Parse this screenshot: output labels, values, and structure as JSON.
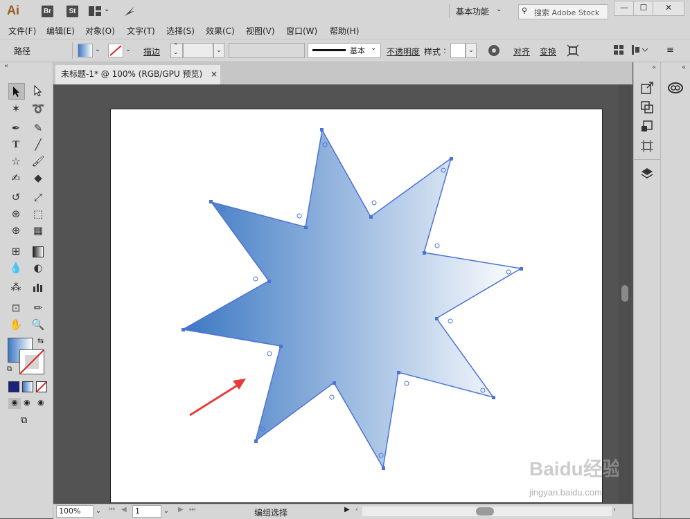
{
  "app": {
    "logo": "Ai",
    "bridge": "Br",
    "stock_app": "St",
    "workspace": "基本功能",
    "search_placeholder": "搜索 Adobe Stock",
    "min": "—",
    "max": "☐",
    "close": "✕"
  },
  "menu": [
    "文件(F)",
    "编辑(E)",
    "对象(O)",
    "文字(T)",
    "选择(S)",
    "效果(C)",
    "视图(V)",
    "窗口(W)",
    "帮助(H)"
  ],
  "control": {
    "selection_type": "路径",
    "stroke_label": "描边",
    "stroke_style": "基本",
    "opacity_label": "不透明度",
    "style_label": "样式",
    "align_label": "对齐",
    "transform_label": "变换"
  },
  "document": {
    "tab_title": "未标题-1* @ 100% (RGB/GPU 预览)",
    "tab_close": "×"
  },
  "status": {
    "zoom": "100%",
    "artboard_num": "1",
    "tool_status": "编组选择"
  },
  "watermark": {
    "line1": "Baidu经验",
    "line2": "jingyan.baidu.com"
  },
  "colors": {
    "gradient_start": "#3c78c3",
    "gradient_end": "#ffffff",
    "path_stroke": "#4c72d8",
    "arrow": "#e83a3a"
  },
  "icons": {
    "selection": "selection-tool-icon",
    "direct_selection": "direct-selection-tool-icon",
    "magic_wand": "magic-wand-icon",
    "lasso": "lasso-icon",
    "pen": "pen-tool-icon",
    "type": "type-tool-icon",
    "line": "line-tool-icon",
    "star": "star-tool-icon",
    "brush": "paintbrush-icon",
    "hand": "hand-tool-icon",
    "zoom": "zoom-tool-icon"
  }
}
